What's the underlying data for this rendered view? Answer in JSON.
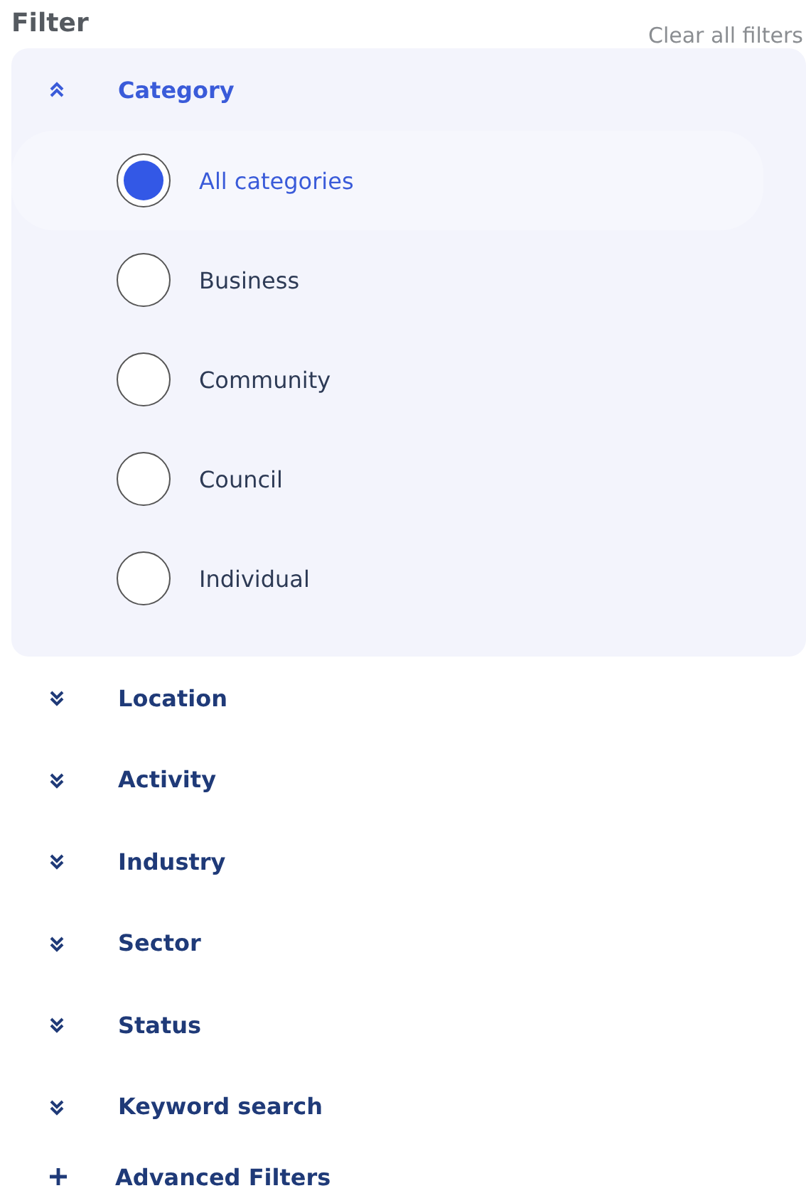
{
  "title": "Filter",
  "clear_link": "Clear all filters",
  "sections": [
    {
      "label": "Category",
      "expanded": true,
      "options": [
        {
          "label": "All categories",
          "selected": true
        },
        {
          "label": "Business",
          "selected": false
        },
        {
          "label": "Community",
          "selected": false
        },
        {
          "label": "Council",
          "selected": false
        },
        {
          "label": "Individual",
          "selected": false
        }
      ]
    },
    {
      "label": "Location",
      "expanded": false
    },
    {
      "label": "Activity",
      "expanded": false
    },
    {
      "label": "Industry",
      "expanded": false
    },
    {
      "label": "Sector",
      "expanded": false
    },
    {
      "label": "Status",
      "expanded": false
    },
    {
      "label": "Keyword search",
      "expanded": false
    }
  ],
  "advanced": "Advanced Filters"
}
